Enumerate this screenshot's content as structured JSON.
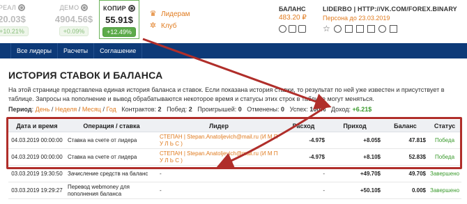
{
  "accounts": [
    {
      "name": "РЕАЛ",
      "amount": "20.03$",
      "change": "+10.21%"
    },
    {
      "name": "ДЕМО",
      "amount": "4904.56$",
      "change": "+0.09%"
    },
    {
      "name": "КОПИР",
      "amount": "55.91$",
      "change": "+12.49%"
    }
  ],
  "links": [
    {
      "label": "Лидерам",
      "icon": "leader-icon"
    },
    {
      "label": "Клуб",
      "icon": "club-icon"
    }
  ],
  "balance": {
    "label": "БАЛАНС",
    "value": "483.20 ₽"
  },
  "profile": {
    "title": "LIDERBO | HTTP://VK.COM/FOREX.BINARY",
    "subtitle": "Персона до 23.03.2019"
  },
  "nav": [
    "",
    "Все лидеры",
    "Расчеты",
    "Соглашение"
  ],
  "page": {
    "title": "ИСТОРИЯ СТАВОК И БАЛАНСА",
    "description": "На этой странице представлена единая история баланса и ставок. Если показана история ставки, то результат по ней уже известен и присутствует в таблице. Запросы на пополнение и вывод обрабатываются некоторое время и статусы этих строк в таблице могут меняться."
  },
  "filter": {
    "period_label": "Период",
    "periods": [
      "День",
      "Неделя",
      "Месяц",
      "Год"
    ],
    "contracts_label": "Контрактов:",
    "contracts": "2",
    "wins_label": "Побед:",
    "wins": "2",
    "losses_label": "Проигрышей:",
    "losses": "0",
    "cancelled_label": "Отменены:",
    "cancelled": "0",
    "success_label": "Успех:",
    "success": "100%",
    "income_label": "Доход:",
    "income": "+6.21$"
  },
  "table": {
    "headers": [
      "Дата и время",
      "Операция / ставка",
      "Лидер",
      "Расход",
      "Приход",
      "Баланс",
      "Статус"
    ],
    "rows": [
      {
        "date": "04.03.2019 00:00:00",
        "op": "Ставка на счете от лидера",
        "leader": "СТЕПАН | Stepan.Anatoljevich@mail.ru (И М П У Л Ь С )",
        "expense": "-4.97$",
        "income": "+8.05$",
        "balance": "47.81$",
        "status": "Победа"
      },
      {
        "date": "04.03.2019 00:00:00",
        "op": "Ставка на счете от лидера",
        "leader": "СТЕПАН | Stepan.Anatoljevich@mail.ru (И М П У Л Ь С )",
        "expense": "-4.97$",
        "income": "+8.10$",
        "balance": "52.83$",
        "status": "Победа"
      },
      {
        "date": "03.03.2019 19:30:50",
        "op": "Зачисление средств на баланс",
        "leader": "-",
        "expense": "-",
        "income": "+49.70$",
        "balance": "49.70$",
        "status": "Завершено"
      },
      {
        "date": "03.03.2019 19:29:27",
        "op": "Перевод webmoney для пополнения баланса",
        "leader": "-",
        "expense": "-",
        "income": "+50.10$",
        "balance": "0.00$",
        "status": "Завершено"
      }
    ]
  },
  "colors": {
    "accent": "#e07b1f",
    "nav": "#0d3a78",
    "highlight": "#b02e2a",
    "success": "#3a9a2c"
  }
}
